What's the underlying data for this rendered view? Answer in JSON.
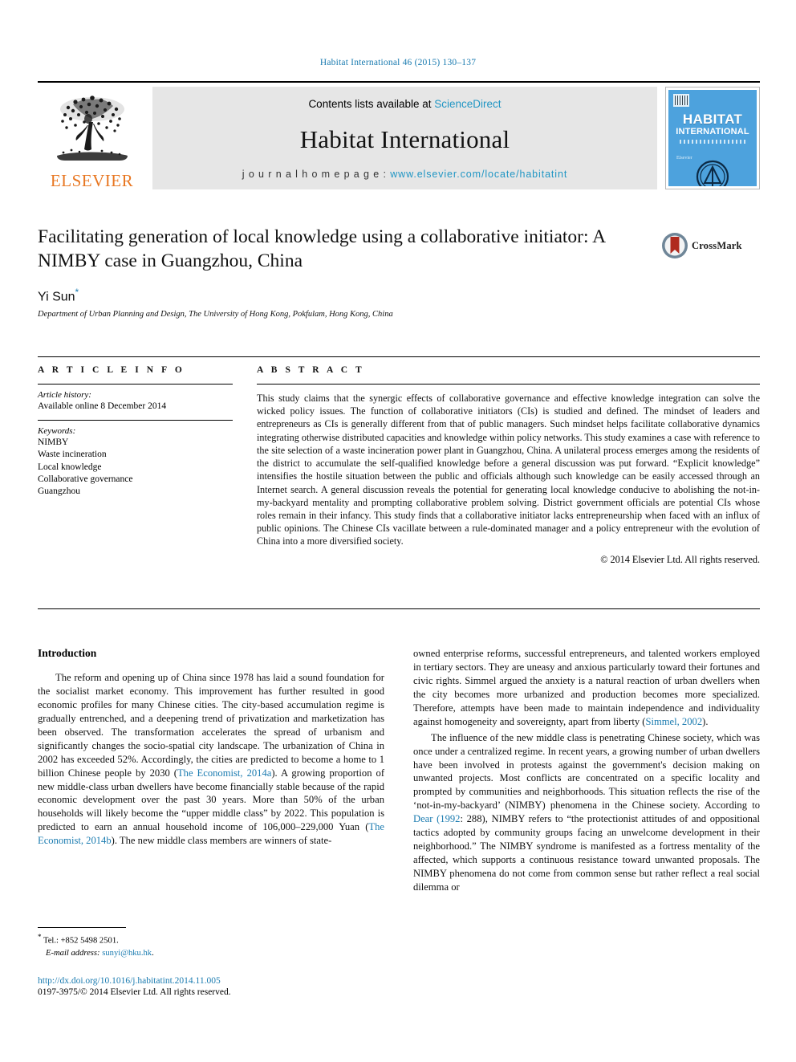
{
  "running_head": "Habitat International 46 (2015) 130–137",
  "banner": {
    "publisher_name": "ELSEVIER",
    "contents_prefix": "Contents lists available at ",
    "contents_link": "ScienceDirect",
    "journal_name": "Habitat International",
    "homepage_label": "j o u r n a l   h o m e p a g e :  ",
    "homepage_url": "www.elsevier.com/locate/habitatint",
    "cover": {
      "title": "HABITAT",
      "subtitle": "INTERNATIONAL",
      "small_note": "Elsevier"
    }
  },
  "article": {
    "title": "Facilitating generation of local knowledge using a collaborative initiator: A NIMBY case in Guangzhou, China",
    "author": "Yi Sun",
    "author_marker": "*",
    "affiliation": "Department of Urban Planning and Design, The University of Hong Kong, Pokfulam, Hong Kong, China",
    "crossmark_label": "CrossMark"
  },
  "info": {
    "heading": "A R T I C L E   I N F O",
    "history_label": "Article history:",
    "history_value": "Available online 8 December 2014",
    "keywords_label": "Keywords:",
    "keywords": [
      "NIMBY",
      "Waste incineration",
      "Local knowledge",
      "Collaborative governance",
      "Guangzhou"
    ]
  },
  "abstract": {
    "heading": "A B S T R A C T",
    "text": "This study claims that the synergic effects of collaborative governance and effective knowledge integration can solve the wicked policy issues. The function of collaborative initiators (CIs) is studied and defined. The mindset of leaders and entrepreneurs as CIs is generally different from that of public managers. Such mindset helps facilitate collaborative dynamics integrating otherwise distributed capacities and knowledge within policy networks. This study examines a case with reference to the site selection of a waste incineration power plant in Guangzhou, China. A unilateral process emerges among the residents of the district to accumulate the self-qualified knowledge before a general discussion was put forward. “Explicit knowledge” intensifies the hostile situation between the public and officials although such knowledge can be easily accessed through an Internet search. A general discussion reveals the potential for generating local knowledge conducive to abolishing the not-in-my-backyard mentality and prompting collaborative problem solving. District government officials are potential CIs whose roles remain in their infancy. This study finds that a collaborative initiator lacks entrepreneurship when faced with an influx of public opinions. The Chinese CIs vacillate between a rule-dominated manager and a policy entrepreneur with the evolution of China into a more diversified society.",
    "copyright": "© 2014 Elsevier Ltd. All rights reserved."
  },
  "body": {
    "section_title": "Introduction",
    "left_paragraph_1a": "The reform and opening up of China since 1978 has laid a sound foundation for the socialist market economy. This improvement has further resulted in good economic profiles for many Chinese cities. The city-based accumulation regime is gradually entrenched, and a deepening trend of privatization and marketization has been observed. The transformation accelerates the spread of urbanism and significantly changes the socio-spatial city landscape. The urbanization of China in 2002 has exceeded 52%. Accordingly, the cities are predicted to become a home to 1 billion Chinese people by 2030 (",
    "cit_economist_a": "The Economist, 2014a",
    "left_paragraph_1b": "). A growing proportion of new middle-class urban dwellers have become financially stable because of the rapid economic development over the past 30 years. More than 50% of the urban households will likely become the “upper middle class” by 2022. This population is predicted to earn an annual household income of 106,000–229,000 Yuan (",
    "cit_economist_b": "The Economist, 2014b",
    "left_paragraph_1c": "). The new middle class members are winners of state-",
    "right_paragraph_1a": "owned enterprise reforms, successful entrepreneurs, and talented workers employed in tertiary sectors. They are uneasy and anxious particularly toward their fortunes and civic rights. Simmel argued the anxiety is a natural reaction of urban dwellers when the city becomes more urbanized and production becomes more specialized. Therefore, attempts have been made to maintain independence and individuality against homogeneity and sovereignty, apart from liberty (",
    "cit_simmel": "Simmel, 2002",
    "right_paragraph_1b": ").",
    "right_paragraph_2a": "The influence of the new middle class is penetrating Chinese society, which was once under a centralized regime. In recent years, a growing number of urban dwellers have been involved in protests against the government's decision making on unwanted projects. Most conflicts are concentrated on a specific locality and prompted by communities and neighborhoods. This situation reflects the rise of the ‘not-in-my-backyard’ (NIMBY) phenomena in the Chinese society. According to ",
    "cit_dear": "Dear (1992",
    "right_paragraph_2b": ": 288), NIMBY refers to “the protectionist attitudes of and oppositional tactics adopted by community groups facing an unwelcome development in their neighborhood.” The NIMBY syndrome is manifested as a fortress mentality of the affected, which supports a continuous resistance toward unwanted proposals. The NIMBY phenomena do not come from common sense but rather reflect a real social dilemma or"
  },
  "footnotes": {
    "tel_marker": "*",
    "tel": " Tel.: +852 5498 2501.",
    "email_label": "E-mail address:",
    "email": "sunyi@hku.hk",
    "email_tail": "."
  },
  "footer": {
    "doi": "http://dx.doi.org/10.1016/j.habitatint.2014.11.005",
    "issn": "0197-3975/© 2014 Elsevier Ltd. All rights reserved."
  },
  "colors": {
    "link_blue": "#1a7bb0",
    "science_direct_blue": "#2196c4",
    "elsevier_orange": "#E87722",
    "cover_blue": "#4da2dd",
    "crossmark_red": "#b02a1e"
  }
}
